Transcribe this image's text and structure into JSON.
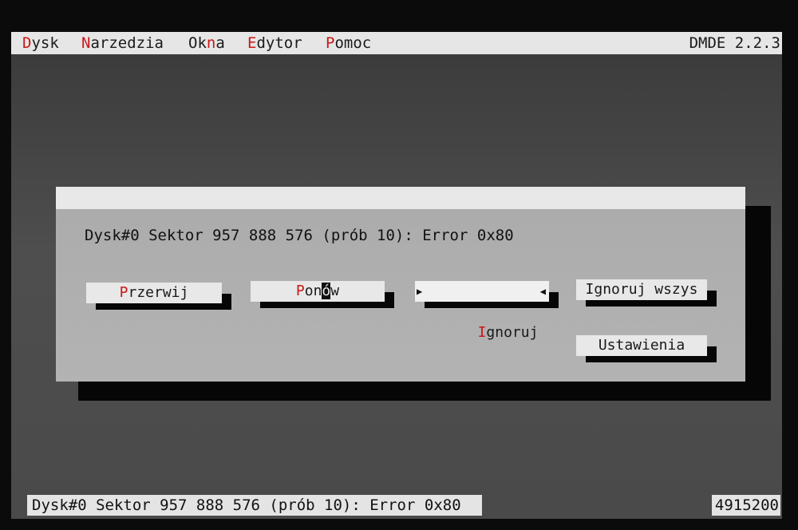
{
  "menubar": {
    "items": [
      {
        "hotkey": "D",
        "rest": "ysk"
      },
      {
        "hotkey": "N",
        "rest": "arzedzia"
      },
      {
        "pre": "Ok",
        "hotkey": "n",
        "rest": "a"
      },
      {
        "hotkey": "E",
        "rest": "dytor"
      },
      {
        "hotkey": "P",
        "rest": "omoc"
      }
    ],
    "app_version": "DMDE 2.2.3"
  },
  "dialog": {
    "message": "Dysk#0 Sektor 957 888 576 (prób 10): Error 0x80",
    "buttons": {
      "abort": {
        "hotkey": "P",
        "rest": "rzerwij"
      },
      "retry": {
        "hotkey": "P",
        "mid": "on",
        "cursor": "ó",
        "rest": "w"
      },
      "ignore": {
        "hotkey": "I",
        "rest": "gnoruj",
        "focused": true
      },
      "ignore_all": {
        "label": "Ignoruj wszys"
      },
      "settings": {
        "label": "Ustawienia"
      }
    }
  },
  "statusbar": {
    "message": "Dysk#0 Sektor 957 888 576 (prób 10): Error 0x80",
    "value": "4915200"
  },
  "colors": {
    "hotkey": "#c81818",
    "menubar_bg": "#e6e6e6",
    "dialog_bg": "#b0b0b0",
    "screen_bg": "#454545"
  },
  "icons": {
    "focus_left": "triangle-right-icon",
    "focus_right": "triangle-left-icon"
  }
}
